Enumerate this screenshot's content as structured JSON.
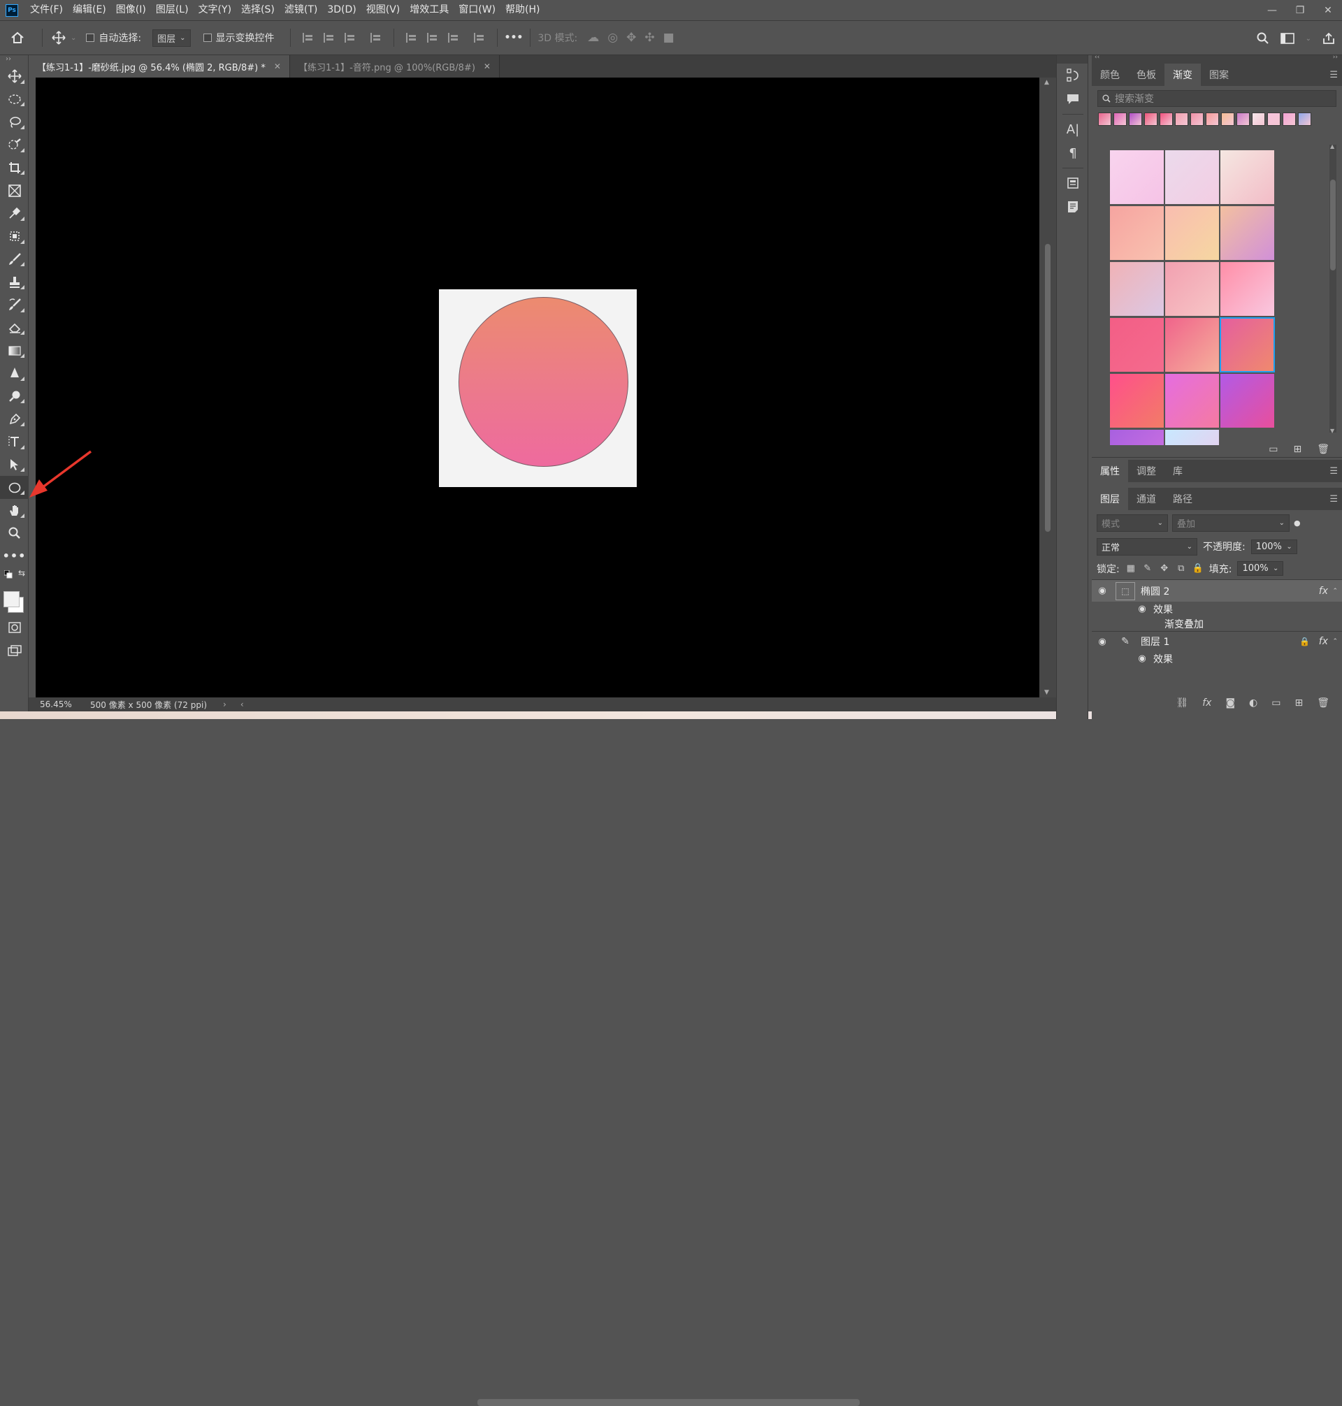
{
  "menubar": {
    "app_logo": "Ps",
    "items": [
      "文件(F)",
      "编辑(E)",
      "图像(I)",
      "图层(L)",
      "文字(Y)",
      "选择(S)",
      "滤镜(T)",
      "3D(D)",
      "视图(V)",
      "增效工具",
      "窗口(W)",
      "帮助(H)"
    ],
    "window_controls": {
      "minimize": "—",
      "restore": "❐",
      "close": "✕"
    }
  },
  "options_bar": {
    "auto_select_label": "自动选择:",
    "auto_select_target": "图层",
    "show_transform_label": "显示变换控件",
    "mode_3d_label": "3D 模式:",
    "more_label": "•••"
  },
  "toolbar": {
    "tools": [
      "move-tool",
      "rect-marquee-tool",
      "lasso-tool",
      "quick-select-tool",
      "crop-tool",
      "frame-tool",
      "eyedropper-tool",
      "spot-heal-tool",
      "brush-tool",
      "clone-stamp-tool",
      "history-brush-tool",
      "eraser-tool",
      "gradient-tool",
      "blur-tool",
      "dodge-tool",
      "pen-tool",
      "type-tool",
      "path-select-tool",
      "ellipse-tool",
      "hand-tool",
      "zoom-tool",
      "edit-toolbar-tool"
    ],
    "selected_tool": "ellipse-tool"
  },
  "document_tabs": [
    {
      "label": "【练习1-1】-磨砂纸.jpg @ 56.4% (椭圆 2, RGB/8#) *",
      "active": true
    },
    {
      "label": "【练习1-1】-音符.png @ 100%(RGB/8#)",
      "active": false
    }
  ],
  "status_bar": {
    "zoom": "56.45%",
    "doc_info": "500 像素 x 500 像素 (72 ppi)"
  },
  "gradient_panel": {
    "tabs": [
      "颜色",
      "色板",
      "渐变",
      "图案"
    ],
    "active_tab": "渐变",
    "search_placeholder": "搜索渐变",
    "presets": [
      "#e8648c",
      "#e066b8",
      "#b04fc6",
      "#ec5579",
      "#f0527e",
      "#f29fae",
      "#ef91a6",
      "#f79b98",
      "#f4bd94",
      "#c97bc8",
      "#f6e6ea",
      "#f7c3dc",
      "#f3a3d3",
      "#8fa7e8"
    ],
    "swatches": [
      {
        "from": "#f8d4ee",
        "to": "#f6c3e6"
      },
      {
        "from": "#ebdaec",
        "to": "#f3cde3"
      },
      {
        "from": "#f4e7e1",
        "to": "#f3bcc7"
      },
      {
        "from": "#f6a4a0",
        "to": "#f9c2b0"
      },
      {
        "from": "#f9bdb0",
        "to": "#f6d7a1"
      },
      {
        "from": "#f3c0a0",
        "to": "#d190d8"
      },
      {
        "from": "#f0b2b6",
        "to": "#dcc8e4"
      },
      {
        "from": "#f2a0b0",
        "to": "#f7c6c7"
      },
      {
        "from": "#ff8ea7",
        "to": "#f9c8e0"
      },
      {
        "from": "#f35e86",
        "to": "#f46b8d"
      },
      {
        "from": "#f0648b",
        "to": "#f5b09b"
      },
      {
        "from": "#e45e9f",
        "to": "#f08a6d"
      },
      {
        "from": "#ff4f8b",
        "to": "#f27c67"
      },
      {
        "from": "#e56de0",
        "to": "#f57aa1"
      },
      {
        "from": "#b25ae6",
        "to": "#e84f9c"
      },
      {
        "from": "#a860e0",
        "to": "#d474e0"
      },
      {
        "from": "#c8e8ff",
        "to": "#f0c8e8"
      }
    ],
    "selected_swatch_index": 11
  },
  "properties_tabs": [
    "属性",
    "调整",
    "库"
  ],
  "layers_panel": {
    "tabs": [
      "图层",
      "通道",
      "路径"
    ],
    "filter_kind": "模式",
    "filter_value": "叠加",
    "blend_mode": "正常",
    "opacity_label": "不透明度:",
    "opacity_value": "100%",
    "lock_label": "锁定:",
    "fill_label": "填充:",
    "fill_value": "100%",
    "layers": [
      {
        "name": "椭圆 2",
        "selected": true,
        "fx": "fx",
        "effects_label": "效果",
        "effect": "渐变叠加"
      },
      {
        "name": "图层 1",
        "selected": false,
        "fx": "fx",
        "effects_label": "效果"
      }
    ]
  },
  "canvas": {
    "background": "#000000",
    "artboard_color": "#f3f3f3",
    "circle_gradient": [
      "#ec8b6f",
      "#ee6a9e"
    ]
  },
  "annotation": {
    "arrow_color": "#e8372c"
  }
}
